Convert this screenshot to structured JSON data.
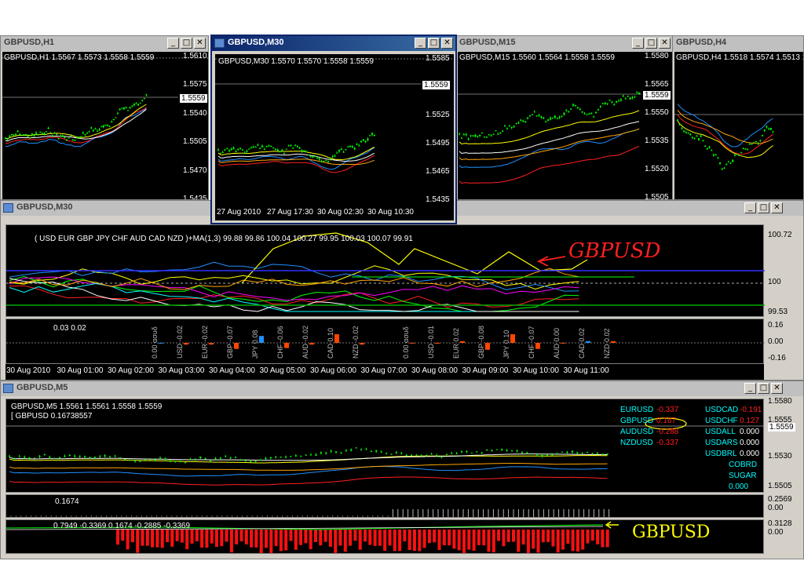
{
  "windows": {
    "w1": {
      "title": "GBPUSD,H1",
      "header": "GBPUSD,H1  1.5567 1.5573 1.5558 1.5559",
      "axis": [
        "1.5610",
        "1.5575",
        "1.5540",
        "1.5505",
        "1.5470",
        "1.5435"
      ],
      "price": "1.5559"
    },
    "w2": {
      "title": "GBPUSD,M30",
      "header": "GBPUSD,M30  1.5570 1.5570 1.5558 1.5559",
      "axis": [
        "1.5585",
        "1.5555",
        "1.5525",
        "1.5495",
        "1.5465",
        "1.5435"
      ],
      "price": "1.5559",
      "times": [
        "27 Aug 2010",
        "27 Aug 17:30",
        "30 Aug 02:30",
        "30 Aug 10:30"
      ]
    },
    "w3": {
      "title": "GBPUSD,M15",
      "header": "GBPUSD,M15  1.5560 1.5564 1.5558 1.5559",
      "axis": [
        "1.5580",
        "1.5565",
        "1.5550",
        "1.5535",
        "1.5520",
        "1.5505"
      ],
      "price": "1.5559"
    },
    "w4": {
      "title": "GBPUSD,H4",
      "header": "GBPUSD,H4  1.5518 1.5574 1.5513 1.5559"
    },
    "w5": {
      "title": "GBPUSD,M30",
      "indicator_label": "( USD EUR GBP JPY CHF AUD CAD NZD )+MA(1,3) 99.88 99.86 100.04 100.27 99.95 100.03 100.07 99.91",
      "annotation": "GBPUSD",
      "axis": [
        "100.72",
        "100",
        "99.53"
      ],
      "sub_label": "0.03 0.02",
      "sub_axis": [
        "0.16",
        "0.00",
        "-0.16"
      ],
      "bar_labels": [
        "0.00 ασυδ",
        "USD -0.02",
        "EUR -0.02",
        "GBP -0.07",
        "JPY 0.08",
        "CHF -0.06",
        "AUD -0.02",
        "CAD 0.10",
        "NZD -0.02",
        "0.00 ασυδ",
        "USD -0.01",
        "EUR 0.02",
        "GBP -0.08",
        "JPY 0.10",
        "CHF -0.07",
        "AUD 0.00",
        "CAD 0.02",
        "NZD 0.02"
      ],
      "times": [
        "30 Aug 2010",
        "30 Aug 01:00",
        "30 Aug 02:00",
        "30 Aug 03:00",
        "30 Aug 04:00",
        "30 Aug 05:00",
        "30 Aug 06:00",
        "30 Aug 07:00",
        "30 Aug 08:00",
        "30 Aug 09:00",
        "30 Aug 10:00",
        "30 Aug 11:00"
      ]
    },
    "w6": {
      "title": "GBPUSD,M5",
      "header": "GBPUSD,M5  1.5561 1.5561 1.5558 1.5559",
      "header2": "[ GBPUSD 0.16738557",
      "axis": [
        "1.5580",
        "1.5555",
        "1.5530",
        "1.5505"
      ],
      "price": "1.5559",
      "pairs_left": [
        {
          "name": "EURUSD",
          "value": "-0.337"
        },
        {
          "name": "GBPUSD",
          "value": "0.167"
        },
        {
          "name": "AUDUSD",
          "value": "-0.288"
        },
        {
          "name": "NZDUSD",
          "value": "-0.337"
        }
      ],
      "pairs_right": [
        {
          "name": "USDCAD",
          "value": "-0.191"
        },
        {
          "name": "USDCHF",
          "value": "0.127"
        },
        {
          "name": "USDALL",
          "value": "0.000"
        },
        {
          "name": "USDARS",
          "value": "0.000"
        },
        {
          "name": "USDBRL",
          "value": "0.000"
        },
        {
          "name": "COBRD",
          "value": ""
        },
        {
          "name": "SUGAR",
          "value": ""
        },
        {
          "name": "0.000",
          "value": ""
        }
      ],
      "sub1_label": "0.1674",
      "sub1_axis": [
        "0.2569",
        "0.00"
      ],
      "sub2_label": "0.7949 -0.3369 0.1674 -0.2885 -0.3369",
      "sub2_axis": [
        "0.3128",
        "0.00"
      ],
      "annotation": "GBPUSD"
    }
  },
  "colors": {
    "accent_red": "#ff2020",
    "candle_green": "#00ff00",
    "highlight_yellow": "#ffff00"
  }
}
